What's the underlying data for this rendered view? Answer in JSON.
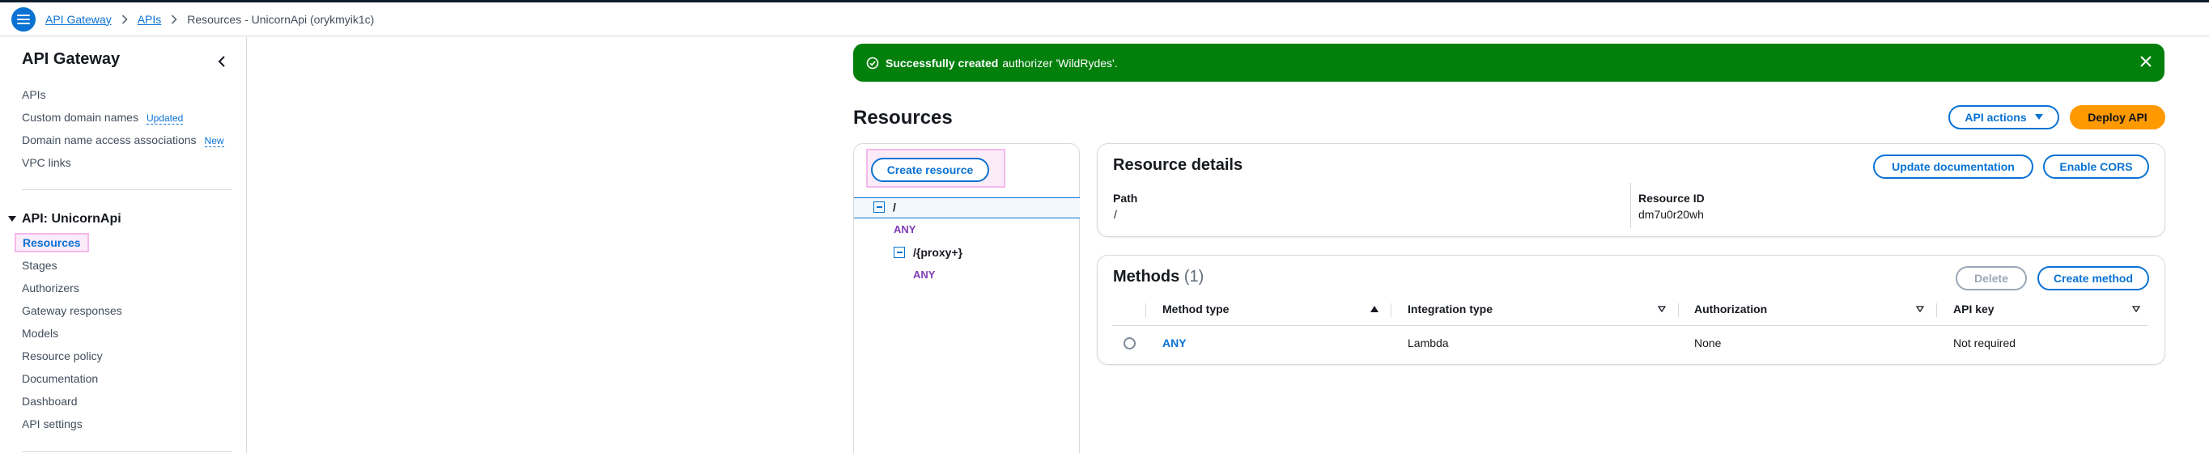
{
  "breadcrumb": {
    "items": [
      "API Gateway",
      "APIs"
    ],
    "current": "Resources - UnicornApi (orykmyik1c)"
  },
  "sidebar": {
    "title": "API Gateway",
    "top_links": [
      {
        "label": "APIs",
        "badge": ""
      },
      {
        "label": "Custom domain names",
        "badge": "Updated"
      },
      {
        "label": "Domain name access associations",
        "badge": "New"
      },
      {
        "label": "VPC links",
        "badge": ""
      }
    ],
    "section_title": "API: UnicornApi",
    "section_links": [
      "Resources",
      "Stages",
      "Authorizers",
      "Gateway responses",
      "Models",
      "Resource policy",
      "Documentation",
      "Dashboard",
      "API settings"
    ],
    "active_item": "Resources"
  },
  "flash": {
    "bold": "Successfully created",
    "text": "authorizer 'WildRydes'.",
    "color": "#037f0c"
  },
  "page": {
    "title": "Resources",
    "api_actions_label": "API actions",
    "deploy_label": "Deploy API"
  },
  "tree": {
    "create_label": "Create resource",
    "root_path": "/",
    "root_method": "ANY",
    "child_path": "/{proxy+}",
    "child_method": "ANY"
  },
  "details": {
    "title": "Resource details",
    "update_doc_label": "Update documentation",
    "enable_cors_label": "Enable CORS",
    "path_label": "Path",
    "path_value": "/",
    "id_label": "Resource ID",
    "id_value": "dm7u0r20wh"
  },
  "methods": {
    "title": "Methods",
    "count": "(1)",
    "delete_label": "Delete",
    "create_label": "Create method",
    "columns": [
      "Method type",
      "Integration type",
      "Authorization",
      "API key"
    ],
    "rows": [
      {
        "method": "ANY",
        "integration": "Lambda",
        "authorization": "None",
        "api_key": "Not required"
      }
    ]
  },
  "colors": {
    "accent": "#0972d3",
    "primary_button": "#ff9900",
    "method_purple": "#7d3cb5",
    "highlight": "#f5b8ec"
  }
}
